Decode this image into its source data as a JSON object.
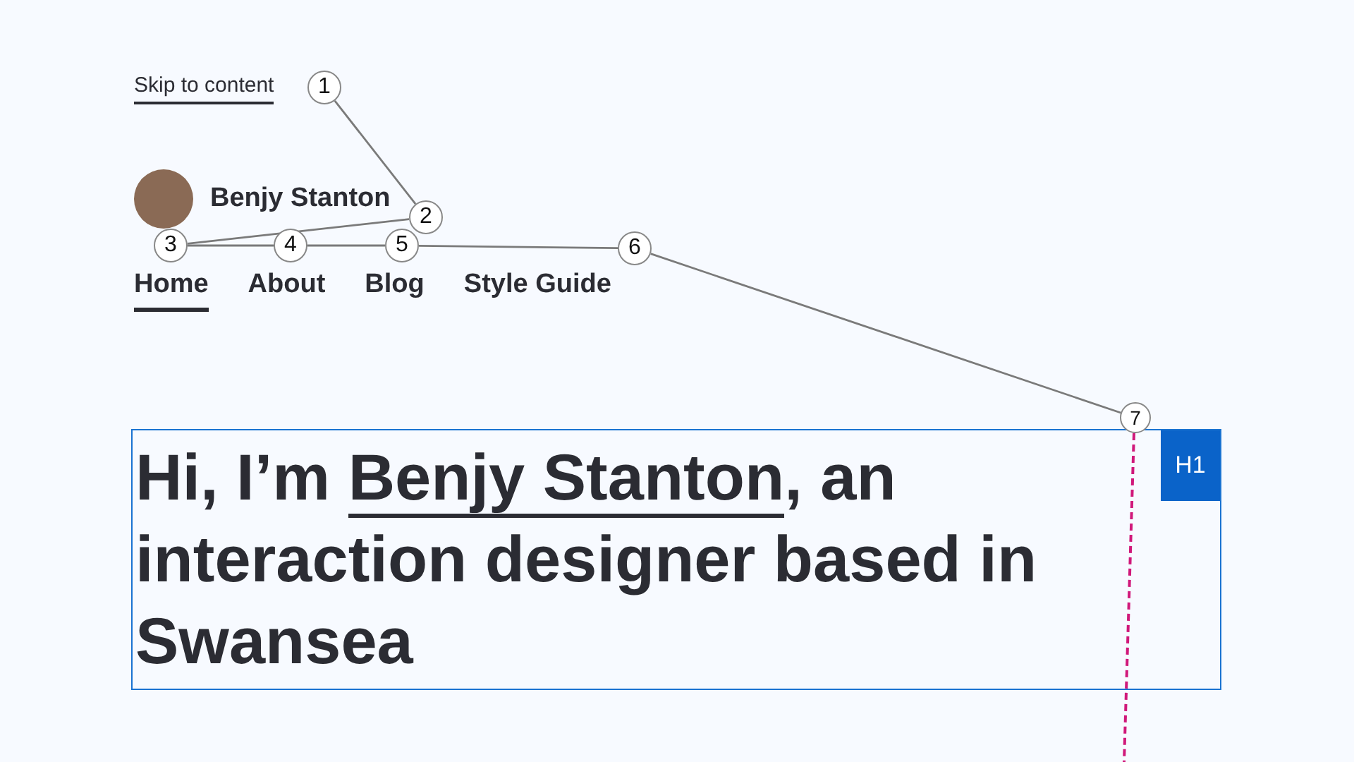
{
  "skip_link": "Skip to content",
  "site_title": "Benjy Stanton",
  "nav": [
    {
      "label": "Home",
      "selected": true
    },
    {
      "label": "About",
      "selected": false
    },
    {
      "label": "Blog",
      "selected": false
    },
    {
      "label": "Style Guide",
      "selected": false
    }
  ],
  "heading": {
    "text_before": "Hi, I’m ",
    "link": "Benjy Stanton",
    "text_after": ", an interaction designer based in Swansea",
    "tag_label": "H1"
  },
  "tab_stops": [
    {
      "number": "1"
    },
    {
      "number": "2"
    },
    {
      "number": "3"
    },
    {
      "number": "4"
    },
    {
      "number": "5"
    },
    {
      "number": "6"
    },
    {
      "number": "7"
    }
  ]
}
